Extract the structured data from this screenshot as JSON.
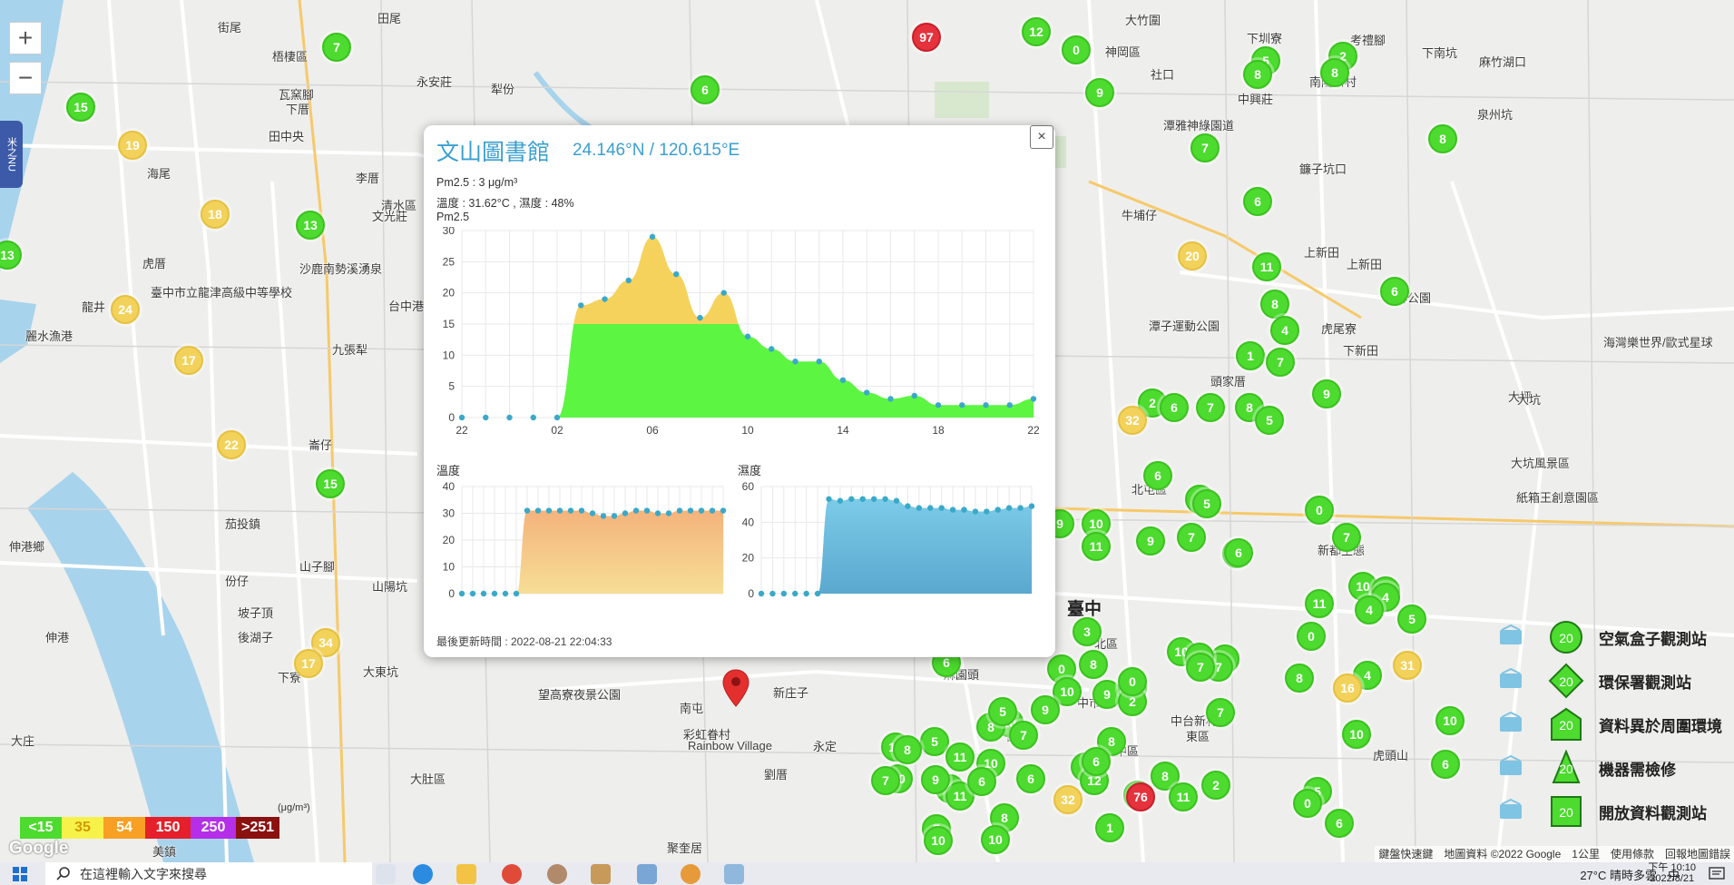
{
  "map": {
    "zoom_in_label": "+",
    "zoom_out_label": "−",
    "side_tab_label": "米之NU",
    "place_labels": [
      {
        "text": "田尾"
      },
      {
        "text": "梧棲區"
      },
      {
        "text": "街尾"
      },
      {
        "text": "永安莊"
      },
      {
        "text": "犁份"
      },
      {
        "text": "瓦窯腳"
      },
      {
        "text": "下厝"
      },
      {
        "text": "田中央"
      },
      {
        "text": "李厝"
      },
      {
        "text": "清水區"
      },
      {
        "text": "海尾"
      },
      {
        "text": "文光莊"
      },
      {
        "text": "虎厝"
      },
      {
        "text": "沙鹿南勢溪湧泉"
      },
      {
        "text": "龍井"
      },
      {
        "text": "臺中市立龍津高級中等學校"
      },
      {
        "text": "台中港"
      },
      {
        "text": "九張犁"
      },
      {
        "text": "麗水漁港"
      },
      {
        "text": "崙仔"
      },
      {
        "text": "茄投鎮"
      },
      {
        "text": "伸港鄉"
      },
      {
        "text": "份仔"
      },
      {
        "text": "山子腳"
      },
      {
        "text": "山陽坑"
      },
      {
        "text": "坡子頂"
      },
      {
        "text": "後湖子"
      },
      {
        "text": "伸港"
      },
      {
        "text": "下寮"
      },
      {
        "text": "大東坑"
      },
      {
        "text": "大肚區"
      },
      {
        "text": "大庄"
      },
      {
        "text": "美鎮"
      },
      {
        "text": "望高寮夜景公園"
      },
      {
        "text": "南屯"
      },
      {
        "text": "彩虹眷村"
      },
      {
        "text": "Rainbow Village"
      },
      {
        "text": "新庄子"
      },
      {
        "text": "永定"
      },
      {
        "text": "劉厝"
      },
      {
        "text": "聚奎居"
      },
      {
        "text": "大竹圍"
      },
      {
        "text": "下圳寮"
      },
      {
        "text": "神岡區"
      },
      {
        "text": "社口"
      },
      {
        "text": "考禮腳"
      },
      {
        "text": "下南坑"
      },
      {
        "text": "麻竹湖口"
      },
      {
        "text": "南陽新村"
      },
      {
        "text": "泉州坑"
      },
      {
        "text": "中興莊"
      },
      {
        "text": "潭雅神綠園道"
      },
      {
        "text": "鐮子坑口"
      },
      {
        "text": "牛埔仔"
      },
      {
        "text": "上新田"
      },
      {
        "text": "石牌公園"
      },
      {
        "text": "虎尾寮"
      },
      {
        "text": "下新田"
      },
      {
        "text": "大坪"
      },
      {
        "text": "海灣樂世界/歐式星球"
      },
      {
        "text": "頭家厝"
      },
      {
        "text": "北屯區"
      },
      {
        "text": "大坑風景區"
      },
      {
        "text": "新都生態"
      },
      {
        "text": "紙箱王創意園區"
      },
      {
        "text": "臺中"
      },
      {
        "text": "北區"
      },
      {
        "text": "西區"
      },
      {
        "text": "中區"
      },
      {
        "text": "東區"
      },
      {
        "text": "中市"
      },
      {
        "text": "麻園頭"
      },
      {
        "text": "中台新村"
      },
      {
        "text": "虎頭山"
      },
      {
        "text": "上新田"
      },
      {
        "text": "大坑"
      },
      {
        "text": "潭子運動公園"
      }
    ],
    "markers": [
      {
        "v": "7",
        "c": "green"
      },
      {
        "v": "15",
        "c": "green"
      },
      {
        "v": "19",
        "c": "yellow"
      },
      {
        "v": "18",
        "c": "yellow"
      },
      {
        "v": "13",
        "c": "green"
      },
      {
        "v": "13",
        "c": "green"
      },
      {
        "v": "24",
        "c": "yellow"
      },
      {
        "v": "17",
        "c": "yellow"
      },
      {
        "v": "22",
        "c": "yellow"
      },
      {
        "v": "15",
        "c": "green"
      },
      {
        "v": "34",
        "c": "yellow"
      },
      {
        "v": "17",
        "c": "yellow"
      },
      {
        "v": "6",
        "c": "green"
      },
      {
        "v": "97",
        "c": "red"
      },
      {
        "v": "12",
        "c": "green"
      },
      {
        "v": "0",
        "c": "green"
      },
      {
        "v": "9",
        "c": "green"
      },
      {
        "v": "5",
        "c": "green"
      },
      {
        "v": "8",
        "c": "green"
      },
      {
        "v": "2",
        "c": "green"
      },
      {
        "v": "8",
        "c": "green"
      },
      {
        "v": "7",
        "c": "green"
      },
      {
        "v": "8",
        "c": "green"
      },
      {
        "v": "6",
        "c": "green"
      },
      {
        "v": "20",
        "c": "yellow"
      },
      {
        "v": "11",
        "c": "green"
      },
      {
        "v": "8",
        "c": "green"
      },
      {
        "v": "4",
        "c": "green"
      },
      {
        "v": "6",
        "c": "green"
      },
      {
        "v": "1",
        "c": "green"
      },
      {
        "v": "7",
        "c": "green"
      },
      {
        "v": "9",
        "c": "green"
      },
      {
        "v": "2",
        "c": "green"
      },
      {
        "v": "6",
        "c": "green"
      },
      {
        "v": "7",
        "c": "green"
      },
      {
        "v": "8",
        "c": "green"
      },
      {
        "v": "5",
        "c": "green"
      },
      {
        "v": "32",
        "c": "yellow"
      },
      {
        "v": "6",
        "c": "green"
      },
      {
        "v": "7",
        "c": "green"
      },
      {
        "v": "5",
        "c": "green"
      },
      {
        "v": "9",
        "c": "green"
      },
      {
        "v": "10",
        "c": "green"
      },
      {
        "v": "11",
        "c": "green"
      },
      {
        "v": "9",
        "c": "green"
      },
      {
        "v": "7",
        "c": "green"
      },
      {
        "v": "9",
        "c": "green"
      },
      {
        "v": "6",
        "c": "green"
      },
      {
        "v": "0",
        "c": "green"
      },
      {
        "v": "7",
        "c": "green"
      },
      {
        "v": "11",
        "c": "green"
      },
      {
        "v": "10",
        "c": "green"
      },
      {
        "v": "8",
        "c": "green"
      },
      {
        "v": "4",
        "c": "green"
      },
      {
        "v": "4",
        "c": "green"
      },
      {
        "v": "5",
        "c": "green"
      },
      {
        "v": "3",
        "c": "green"
      },
      {
        "v": "10",
        "c": "green"
      },
      {
        "v": "0",
        "c": "green"
      },
      {
        "v": "9",
        "c": "green"
      },
      {
        "v": "0",
        "c": "green"
      },
      {
        "v": "10",
        "c": "green"
      },
      {
        "v": "9",
        "c": "green"
      },
      {
        "v": "7",
        "c": "green"
      },
      {
        "v": "2",
        "c": "green"
      },
      {
        "v": "8",
        "c": "green"
      },
      {
        "v": "0",
        "c": "green"
      },
      {
        "v": "7",
        "c": "green"
      },
      {
        "v": "31",
        "c": "yellow"
      },
      {
        "v": "8",
        "c": "green"
      },
      {
        "v": "4",
        "c": "green"
      },
      {
        "v": "16",
        "c": "yellow"
      },
      {
        "v": "10",
        "c": "green"
      },
      {
        "v": "7",
        "c": "green"
      },
      {
        "v": "7",
        "c": "green"
      },
      {
        "v": "2",
        "c": "green"
      },
      {
        "v": "6",
        "c": "green"
      },
      {
        "v": "6",
        "c": "green"
      },
      {
        "v": "5",
        "c": "green"
      },
      {
        "v": "0",
        "c": "green"
      },
      {
        "v": "10",
        "c": "green"
      },
      {
        "v": "10",
        "c": "green"
      },
      {
        "v": "10",
        "c": "green"
      },
      {
        "v": "8",
        "c": "green"
      },
      {
        "v": "8",
        "c": "green"
      },
      {
        "v": "6",
        "c": "green"
      },
      {
        "v": "9",
        "c": "green"
      },
      {
        "v": "5",
        "c": "green"
      },
      {
        "v": "7",
        "c": "green"
      },
      {
        "v": "7",
        "c": "green"
      },
      {
        "v": "12",
        "c": "green"
      },
      {
        "v": "6",
        "c": "green"
      },
      {
        "v": "12",
        "c": "green"
      },
      {
        "v": "1",
        "c": "green"
      },
      {
        "v": "8",
        "c": "green"
      },
      {
        "v": "8",
        "c": "green"
      },
      {
        "v": "6",
        "c": "green"
      },
      {
        "v": "32",
        "c": "yellow"
      },
      {
        "v": "76",
        "c": "red"
      },
      {
        "v": "11",
        "c": "green"
      },
      {
        "v": "10",
        "c": "green"
      },
      {
        "v": "5",
        "c": "green"
      },
      {
        "v": "11",
        "c": "green"
      },
      {
        "v": "0",
        "c": "green"
      },
      {
        "v": "12",
        "c": "green"
      },
      {
        "v": "10",
        "c": "green"
      },
      {
        "v": "11",
        "c": "green"
      },
      {
        "v": "6",
        "c": "green"
      },
      {
        "v": "8",
        "c": "green"
      },
      {
        "v": "9",
        "c": "green"
      },
      {
        "v": "7",
        "c": "green"
      },
      {
        "v": "10",
        "c": "green"
      },
      {
        "v": "10",
        "c": "green"
      },
      {
        "v": "7",
        "c": "green"
      }
    ]
  },
  "popup": {
    "close_label": "×",
    "title": "文山圖書館",
    "coords": "24.146°N / 120.615°E",
    "pm25_line": "Pm2.5 : 3 μg/m³",
    "temp_hum_line": "溫度 : 31.62°C , 濕度 : 48%",
    "pm_label": "Pm2.5",
    "temp_label": "溫度",
    "hum_label": "濕度",
    "updated": "最後更新時間 : 2022-08-21 22:04:33"
  },
  "chart_data": [
    {
      "type": "area",
      "title": "Pm2.5",
      "xlabel": "",
      "ylabel": "",
      "x_ticks": [
        "22",
        "02",
        "06",
        "10",
        "14",
        "18",
        "22"
      ],
      "ylim": [
        0,
        30
      ],
      "y_ticks": [
        0,
        5,
        10,
        15,
        20,
        25,
        30
      ],
      "threshold": 15,
      "colors": {
        "below": "#5cf542",
        "above": "#f4d25c",
        "points": "#3aa9c9"
      },
      "grid": true,
      "values": [
        0,
        0,
        0,
        0,
        0,
        18,
        19,
        22,
        29,
        23,
        16,
        20,
        13,
        11,
        9,
        9,
        6,
        4,
        3,
        3.5,
        2,
        2,
        2,
        2,
        3
      ]
    },
    {
      "type": "area",
      "title": "溫度",
      "xlabel": "",
      "ylabel": "",
      "ylim": [
        0,
        40
      ],
      "y_ticks": [
        0,
        10,
        20,
        30,
        40
      ],
      "colors": {
        "top": "#f4b37c",
        "bottom": "#f6de96",
        "points": "#3aa9c9"
      },
      "grid": true,
      "values": [
        0,
        0,
        0,
        0,
        0,
        0,
        31,
        31,
        31,
        31,
        31,
        31,
        30,
        29,
        29,
        30,
        31,
        31,
        30,
        30,
        31,
        31,
        31,
        31,
        31
      ]
    },
    {
      "type": "area",
      "title": "濕度",
      "xlabel": "",
      "ylabel": "",
      "ylim": [
        0,
        60
      ],
      "y_ticks": [
        0,
        20,
        40,
        60
      ],
      "colors": {
        "top": "#7ccbe8",
        "bottom": "#5aa8cf",
        "points": "#3aa9c9"
      },
      "grid": true,
      "values": [
        0,
        0,
        0,
        0,
        0,
        0,
        53,
        52,
        53,
        53,
        53,
        53,
        52,
        49,
        48,
        48,
        48,
        47,
        47,
        46,
        46,
        47,
        48,
        48,
        49
      ]
    }
  ],
  "aqi_legend": {
    "unit": "(μg/m³)",
    "cells": [
      {
        "label": "<15",
        "color": "#4cdb2e",
        "text_color": "#ffffff"
      },
      {
        "label": "35",
        "color": "#f7f24a",
        "text_color": "#d19a00"
      },
      {
        "label": "54",
        "color": "#f7a024",
        "text_color": "#ffffff"
      },
      {
        "label": "150",
        "color": "#e5202a",
        "text_color": "#ffffff"
      },
      {
        "label": "250",
        "color": "#b52ee8",
        "text_color": "#ffffff"
      },
      {
        "label": ">251",
        "color": "#8b1010",
        "text_color": "#ffffff"
      }
    ]
  },
  "station_legend": [
    {
      "label": "空氣盒子觀測站",
      "badge": "20",
      "icon": "cloud-box-icon"
    },
    {
      "label": "環保署觀測站",
      "badge": "20",
      "icon": "government-building-icon"
    },
    {
      "label": "資料異於周圍環境",
      "badge": "20",
      "icon": "house-icon"
    },
    {
      "label": "機器需檢修",
      "badge": "20",
      "icon": "traffic-cone-icon"
    },
    {
      "label": "開放資料觀測站",
      "badge": "20",
      "icon": "ship-icon"
    }
  ],
  "map_footer": {
    "shortcuts": "鍵盤快速鍵",
    "copyright": "地圖資料 ©2022 Google",
    "scale": "1公里",
    "terms": "使用條款",
    "report": "回報地圖錯誤"
  },
  "google_logo": "Google",
  "taskbar": {
    "search_placeholder": "在這裡輸入文字來搜尋",
    "weather": "27°C 晴時多雲",
    "ime": "中",
    "time": "下午 10:10",
    "date": "2022/8/21"
  }
}
